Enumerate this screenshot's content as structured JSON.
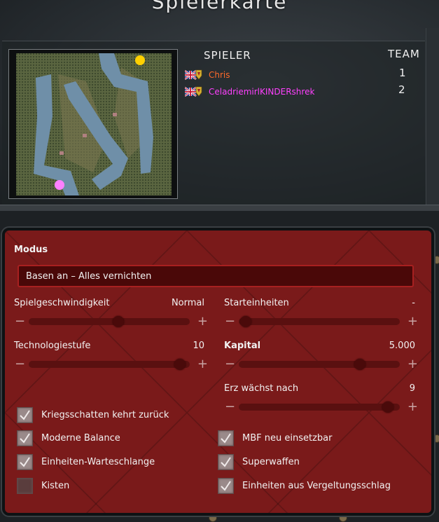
{
  "title": "Spielerkarte",
  "players_header": "SPIELER",
  "team_header": "TEAM",
  "players": [
    {
      "name": "Chris",
      "team": "1",
      "color": "#ff6a2a"
    },
    {
      "name": "CeladriemirlKINDERshrek",
      "team": "2",
      "color": "#ff40ff"
    }
  ],
  "map": {
    "start_colors": [
      "#ffd000",
      "#ff80ff"
    ]
  },
  "settings": {
    "mode_label": "Modus",
    "mode_value": "Basen an – Alles vernichten",
    "speed_label": "Spielgeschwindigkeit",
    "speed_value": "Normal",
    "start_units_label": "Starteinheiten",
    "start_units_value": "-",
    "tech_label": "Technologiestufe",
    "tech_value": "10",
    "credits_label": "Kapital",
    "credits_value": "5.000",
    "ore_label": "Erz wächst nach",
    "ore_value": "9",
    "minus": "−",
    "plus": "+",
    "checkboxes_left": [
      {
        "label": "Kriegsschatten kehrt zurück",
        "checked": true
      },
      {
        "label": "Moderne Balance",
        "checked": true
      },
      {
        "label": "Einheiten-Warteschlange",
        "checked": true
      },
      {
        "label": "Kisten",
        "checked": false
      }
    ],
    "checkboxes_right": [
      {
        "label": "MBF neu einsetzbar",
        "checked": true
      },
      {
        "label": "Superwaffen",
        "checked": true
      },
      {
        "label": "Einheiten aus Vergeltungsschlag",
        "checked": true
      }
    ]
  },
  "colors": {
    "panel_red": "#7a1a1a",
    "player1": "#ff6a2a",
    "player2": "#ff40ff"
  }
}
